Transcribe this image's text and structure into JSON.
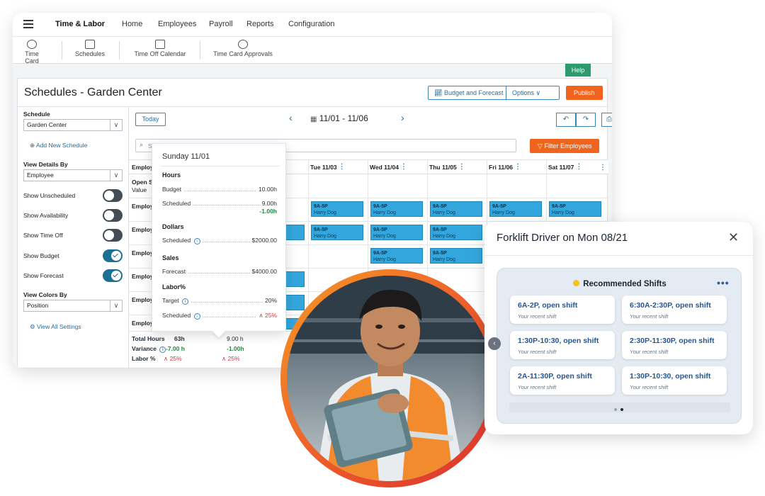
{
  "topnav": {
    "brand": "Time & Labor",
    "links": [
      "Home",
      "Employees",
      "Payroll",
      "Reports",
      "Configuration"
    ]
  },
  "subnav": {
    "items": [
      "Time Card",
      "Schedules",
      "Time Off Calendar",
      "Time Card Approvals"
    ]
  },
  "help_label": "Help",
  "page": {
    "title": "Schedules - Garden Center",
    "budget_button": "Budget and Forecast",
    "options_button": "Options",
    "publish_button": "Publish"
  },
  "left": {
    "schedule_label": "Schedule",
    "schedule_value": "Garden Center",
    "add_schedule": "Add New Schedule",
    "view_details_label": "View Details By",
    "view_details_value": "Employee",
    "toggles": [
      {
        "label": "Show Unscheduled",
        "on": false
      },
      {
        "label": "Show Availability",
        "on": false
      },
      {
        "label": "Show Time Off",
        "on": false
      },
      {
        "label": "Show Budget",
        "on": true
      },
      {
        "label": "Show Forecast",
        "on": true
      }
    ],
    "view_colors_label": "View Colors By",
    "view_colors_value": "Position",
    "view_all_settings": "View All Settings"
  },
  "grid": {
    "today": "Today",
    "date_range": "11/01 - 11/06",
    "search_placeholder": "S",
    "filter_button": "Filter Employees",
    "first_col": "Employ",
    "columns": [
      "Tue 11/03",
      "Wed 11/04",
      "Thu 11/05",
      "Fri 11/06",
      "Sat 11/07"
    ],
    "open_label": "Open S",
    "open_sub": "Value",
    "row_label": "Employ",
    "shift_time": "9A-5P",
    "shift_name": "Harry Dog",
    "totals": {
      "total_label": "Total Hours",
      "total_value": "63h",
      "total_sun": "9.00 h",
      "variance_label": "Variance",
      "variance_value": "-7.00 h",
      "variance_sun": "-1.00h",
      "labor_label": "Labor %",
      "labor_value": "25%",
      "labor_sun": "25%"
    }
  },
  "popover": {
    "title": "Sunday 11/01",
    "hours_header": "Hours",
    "budget_label": "Budget",
    "budget_value": "10.00h",
    "scheduled_label": "Scheduled",
    "scheduled_value": "9.00h",
    "scheduled_diff": "-1.00h",
    "dollars_header": "Dollars",
    "dollars_scheduled_label": "Scheduled",
    "dollars_scheduled_value": "$2000.00",
    "sales_header": "Sales",
    "forecast_label": "Forecast",
    "forecast_value": "$4000.00",
    "labor_header": "Labor%",
    "target_label": "Target",
    "target_value": "20%",
    "labor_scheduled_label": "Scheduled",
    "labor_scheduled_value": "25%"
  },
  "card": {
    "title": "Forklift Driver on Mon 08/21",
    "rec_title": "Recommended Shifts",
    "shifts": [
      {
        "time": "6A-2P, open shift",
        "sub": "Your recent shift"
      },
      {
        "time": "6:30A-2:30P, open shift",
        "sub": "Your recent shift"
      },
      {
        "time": "1:30P-10:30, open shift",
        "sub": "Your recent shift"
      },
      {
        "time": "2:30P-11:30P, open shift",
        "sub": "Your recent shift"
      },
      {
        "time": "2A-11:30P, open shift",
        "sub": "Your recent shift"
      },
      {
        "time": "1:30P-10:30, open shift",
        "sub": "Your recent shift"
      }
    ]
  },
  "colors": {
    "accent": "#2a6d99",
    "orange": "#f0641e",
    "shift": "#33a7dd",
    "help": "#2e9b6e"
  }
}
